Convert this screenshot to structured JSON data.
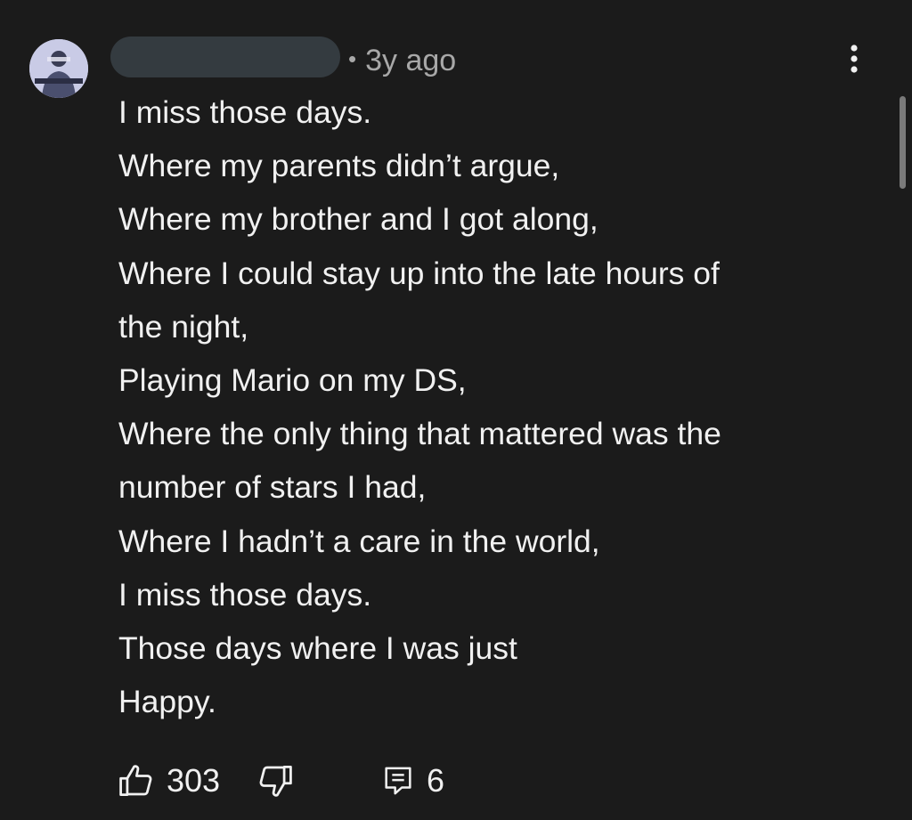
{
  "comment": {
    "author_name_redacted": true,
    "timestamp": "3y ago",
    "separator": "•",
    "lines": [
      "I miss those days.",
      "Where my parents didn’t argue,",
      "Where my brother and I got along,",
      "Where I could stay up into the late hours of",
      "the night,",
      "Playing Mario on my DS,",
      "Where the only thing that mattered was the",
      "number of stars I had,",
      "Where I hadn’t a care in the world,",
      "I miss those days.",
      "Those days where I was just",
      "Happy."
    ],
    "likes": "303",
    "replies": "6"
  },
  "icons": {
    "avatar": "avatar-image",
    "menu": "more-vertical-icon",
    "like": "thumbs-up-icon",
    "dislike": "thumbs-down-icon",
    "reply": "comment-reply-icon"
  },
  "colors": {
    "background": "#1b1b1b",
    "text": "#f1f1f1",
    "secondary_text": "#a8a8a8",
    "redaction": "#343b40",
    "avatar_bg": "#c9cbe6"
  }
}
